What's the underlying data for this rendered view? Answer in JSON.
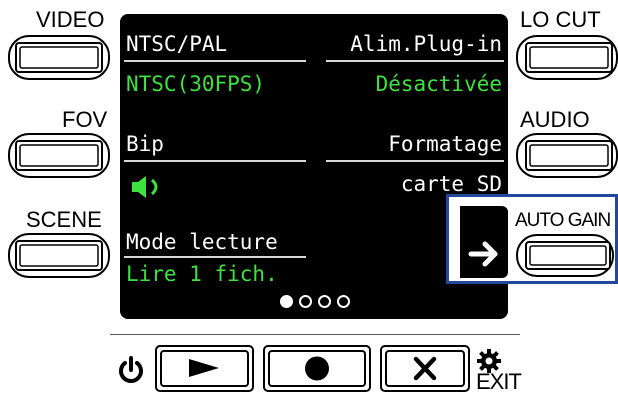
{
  "side_buttons": {
    "video": "VIDEO",
    "fov": "FOV",
    "scene": "SCENE",
    "lo_cut": "LO CUT",
    "audio": "AUDIO",
    "auto_gain": "AUTO GAIN"
  },
  "screen": {
    "ntsc_pal": {
      "label": "NTSC/PAL",
      "value": "NTSC(30FPS)"
    },
    "alim_plugin": {
      "label": "Alim.Plug-in",
      "value": "Désactivée"
    },
    "bip": {
      "label": "Bip",
      "value_icon": "speaker-on-icon"
    },
    "formatage": {
      "label": "Formatage",
      "value": "carte SD"
    },
    "mode_lecture": {
      "label": "Mode lecture",
      "value": "Lire 1 fich."
    },
    "page_indicator": {
      "current": 1,
      "total": 4
    },
    "next_icon": "arrow-right-icon"
  },
  "bottom_buttons": {
    "power_icon": "power-icon",
    "play_icon": "play-icon",
    "record_icon": "record-icon",
    "cancel_icon": "x-icon",
    "settings_icon": "gear-icon",
    "exit_label": "EXIT"
  },
  "colors": {
    "screen_bg": "#000000",
    "value_green": "#3ee13e",
    "highlight_blue": "#23479a"
  }
}
